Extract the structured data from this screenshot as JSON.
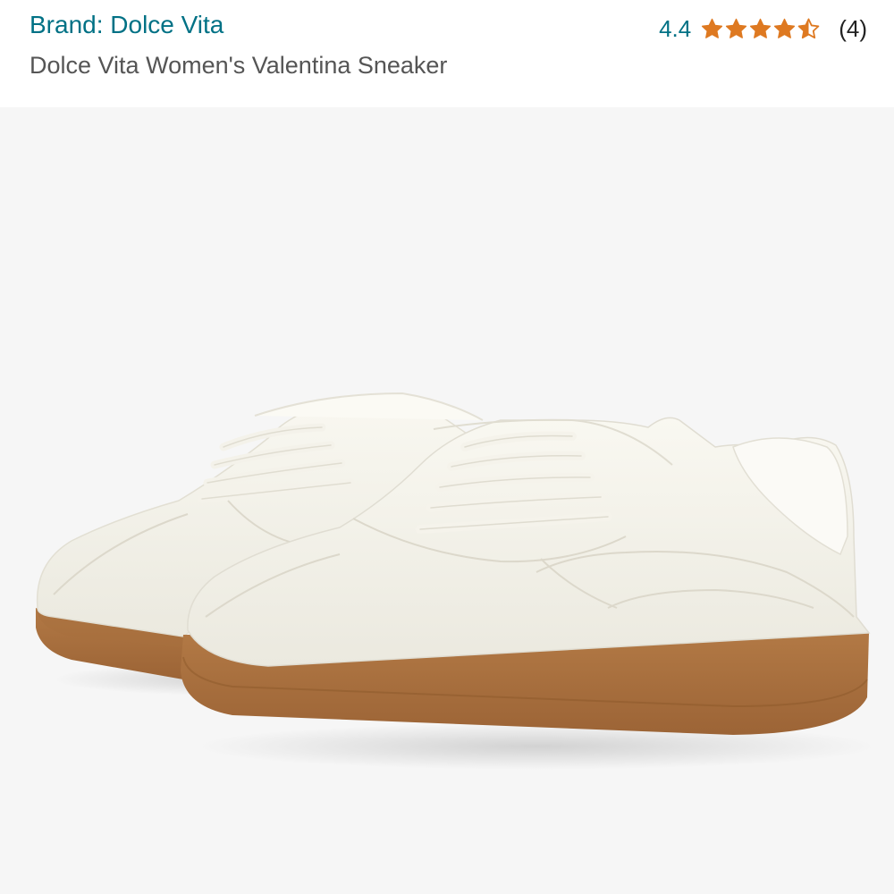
{
  "product": {
    "brand_label": "Brand: Dolce Vita",
    "title": "Dolce Vita Women's Valentina Sneaker",
    "rating_value": "4.4",
    "rating_stars": 4.4,
    "rating_max": 5,
    "review_count": "(4)"
  },
  "icons": {
    "star_full": "star-icon",
    "star_partial": "star-half-icon"
  },
  "colors": {
    "link": "#007185",
    "star": "#de7921",
    "title": "#555555",
    "image_bg": "#f6f6f6"
  }
}
